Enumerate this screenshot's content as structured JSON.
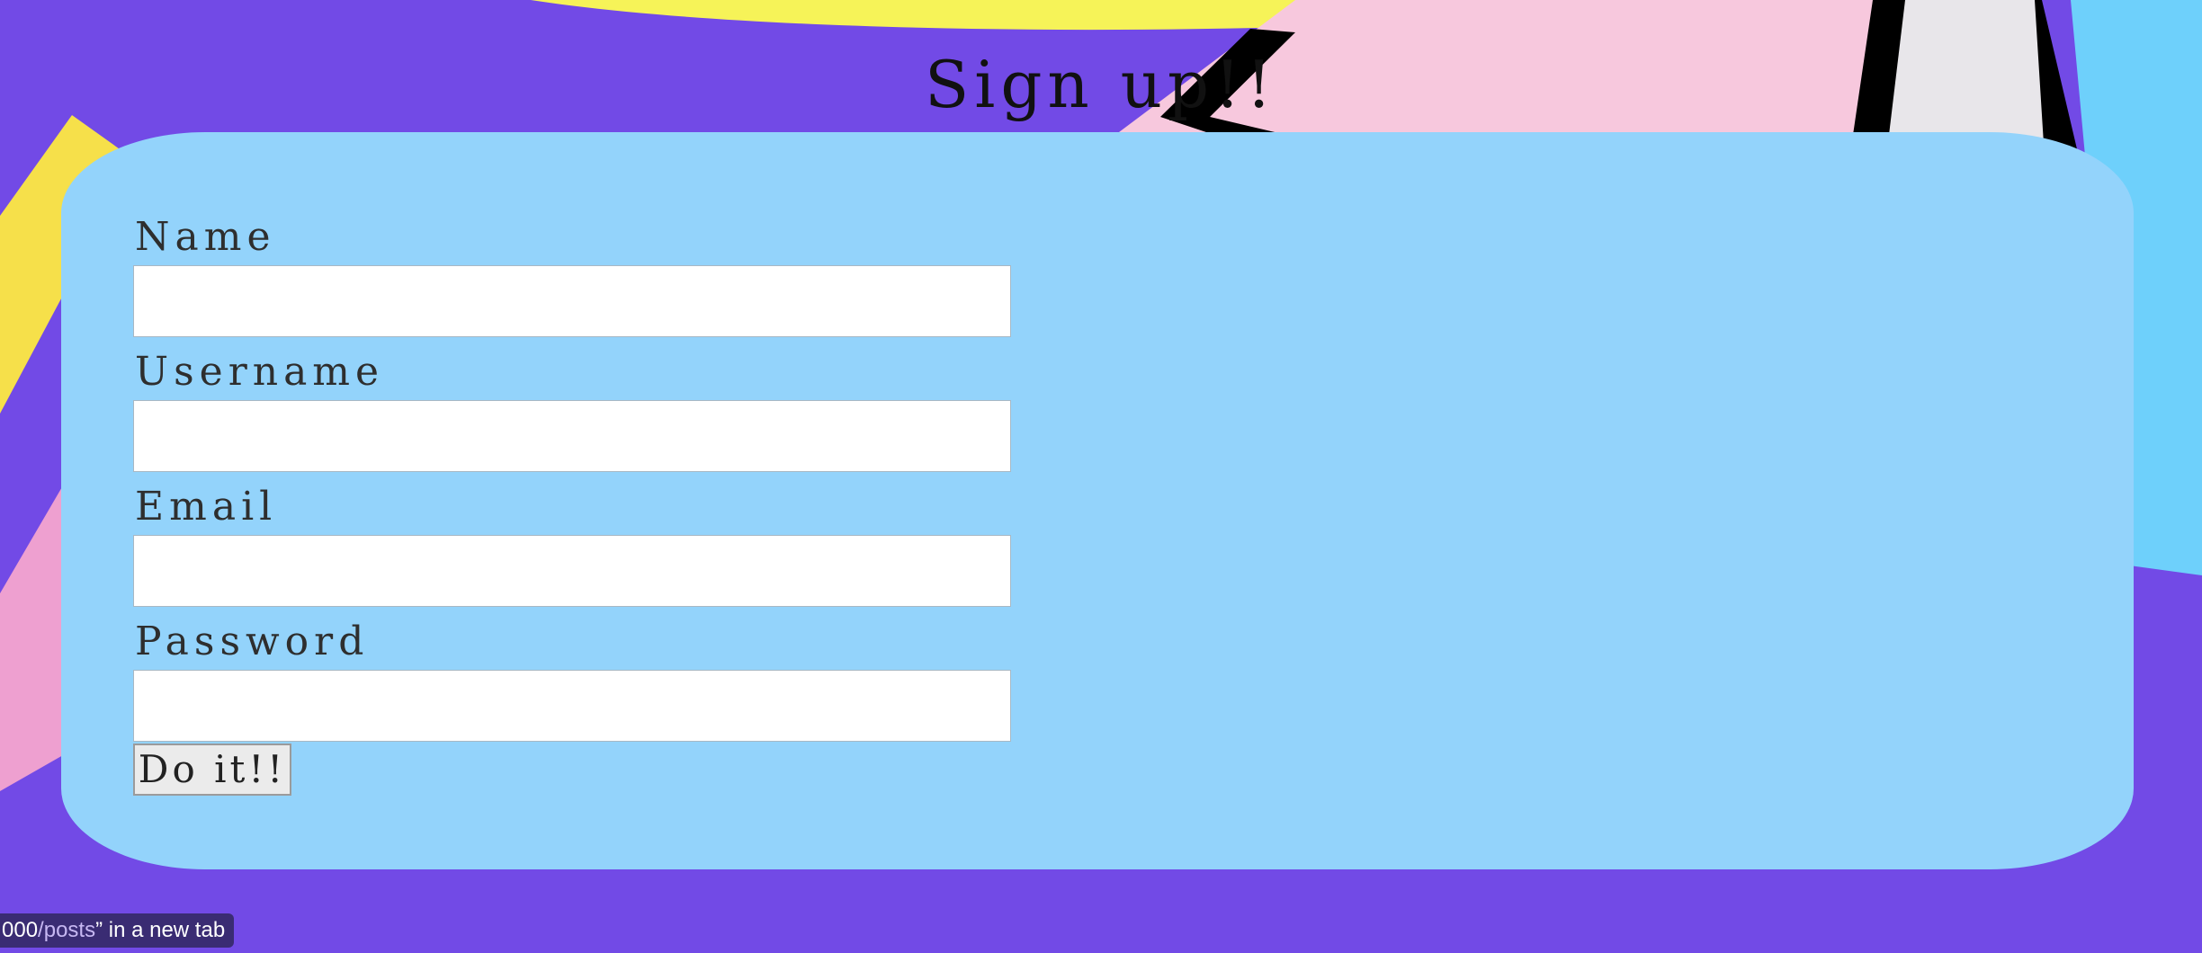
{
  "page": {
    "title": "Sign up!!"
  },
  "form": {
    "fields": [
      {
        "label": "Name",
        "value": "",
        "placeholder": ""
      },
      {
        "label": "Username",
        "value": "",
        "placeholder": ""
      },
      {
        "label": "Email",
        "value": "",
        "placeholder": ""
      },
      {
        "label": "Password",
        "value": "",
        "placeholder": ""
      }
    ],
    "submit_label": "Do it!!"
  },
  "status_bar": {
    "url_prefix": "000",
    "url_path": "/posts",
    "suffix": "” in a new tab"
  },
  "colors": {
    "background": "#724ae6",
    "card": "#93d3fb",
    "yellow_shape": "#f6f358",
    "pink_shape": "#f7c8dd",
    "cyan_shape": "#6ed0fb"
  }
}
